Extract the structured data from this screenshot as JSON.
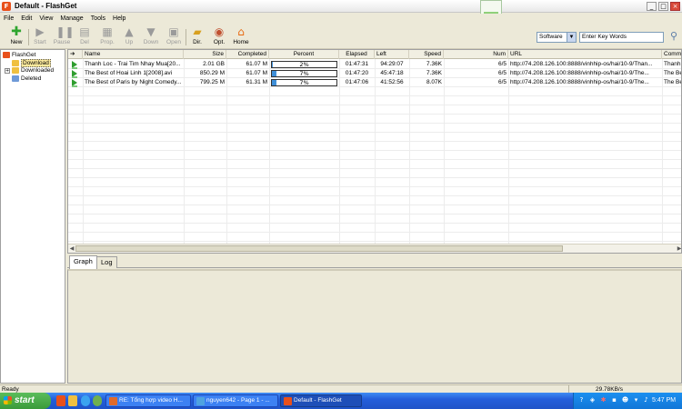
{
  "window": {
    "title": "Default - FlashGet",
    "app_logo": "F"
  },
  "menu": [
    "File",
    "Edit",
    "View",
    "Manage",
    "Tools",
    "Help"
  ],
  "toolbar": {
    "buttons": [
      {
        "label": "New",
        "icon": "plus-icon",
        "enabled": true
      },
      {
        "label": "Start",
        "icon": "play-icon",
        "enabled": false
      },
      {
        "label": "Pause",
        "icon": "pause-icon",
        "enabled": false
      },
      {
        "label": "Del",
        "icon": "delete-icon",
        "enabled": false
      },
      {
        "label": "Prop.",
        "icon": "properties-icon",
        "enabled": false
      },
      {
        "label": "Up",
        "icon": "arrow-up-icon",
        "enabled": false
      },
      {
        "label": "Down",
        "icon": "arrow-down-icon",
        "enabled": false
      },
      {
        "label": "Open",
        "icon": "open-folder-icon",
        "enabled": false
      },
      {
        "label": "Dir.",
        "icon": "directory-icon",
        "enabled": true
      },
      {
        "label": "Opt.",
        "icon": "options-icon",
        "enabled": true
      },
      {
        "label": "Home",
        "icon": "home-icon",
        "enabled": true
      }
    ]
  },
  "search": {
    "category": "Software",
    "placeholder": "Enter Key Words"
  },
  "tree": {
    "root": "FlashGet",
    "items": [
      "Download",
      "Downloaded",
      "Deleted"
    ],
    "selected": "Download"
  },
  "columns": [
    "Name",
    "Size",
    "Completed",
    "Percent",
    "Elapsed",
    "Left",
    "Speed",
    "Num",
    "URL",
    "Comm"
  ],
  "tasks": [
    {
      "name": "Thanh Loc - Trai Tim Nhay Mua[20...",
      "size": "2.01 GB",
      "completed": "61.07 M",
      "percent": "2%",
      "percent_value": 2,
      "elapsed": "01:47:31",
      "left": "94:29:07",
      "speed": "7.36K",
      "num": "6/5",
      "url": "http://74.208.126.100:8888/vinhhip-os/hai/10-9/Than...",
      "comm": "Thanh"
    },
    {
      "name": "The Best of Hoai Linh 1[2008].avi",
      "size": "850.29 M",
      "completed": "61.07 M",
      "percent": "7%",
      "percent_value": 7,
      "elapsed": "01:47:20",
      "left": "45:47:18",
      "speed": "7.36K",
      "num": "6/5",
      "url": "http://74.208.126.100:8888/vinhhip-os/hai/10-9/The...",
      "comm": "The Be"
    },
    {
      "name": "The Best of Paris by Night Comedy...",
      "size": "799.25 M",
      "completed": "61.31 M",
      "percent": "7%",
      "percent_value": 7,
      "elapsed": "01:47:06",
      "left": "41:52:56",
      "speed": "8.07K",
      "num": "6/5",
      "url": "http://74.208.126.100:8888/vinhhip-os/hai/10-9/The...",
      "comm": "The Be"
    }
  ],
  "bottom_tabs": [
    "Graph",
    "Log"
  ],
  "status": {
    "text": "Ready",
    "speed": "29.78KB/s"
  },
  "taskbar": {
    "start": "start",
    "buttons": [
      "RE: Tổng hợp video H...",
      "nguyen642 - Page 1 - ...",
      "Default - FlashGet"
    ],
    "clock": "5:47 PM"
  },
  "colors": {
    "progress": "#3f8fd8",
    "selection": "#fbe99c",
    "taskbar": "#245edb",
    "start": "#3a9a3a"
  }
}
